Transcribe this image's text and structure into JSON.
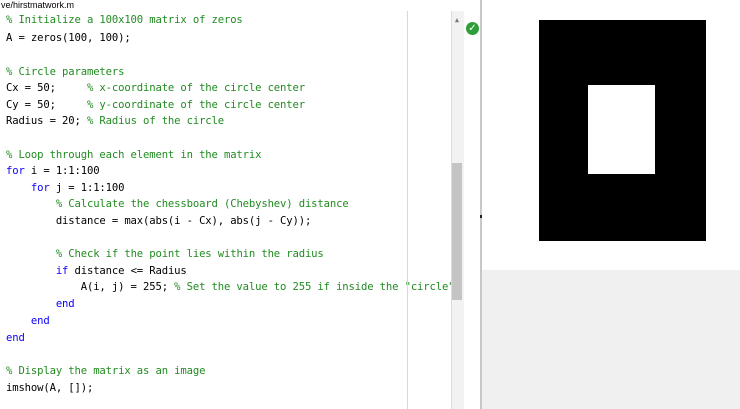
{
  "editor": {
    "file_path": "ve/hirstmatwork.m",
    "lines": [
      [
        {
          "t": "% Initialize a 100x100 matrix of zeros",
          "c": "cm"
        }
      ],
      [
        {
          "t": "A = zeros(100, 100);",
          "c": ""
        }
      ],
      [],
      [
        {
          "t": "% Circle parameters",
          "c": "cm"
        }
      ],
      [
        {
          "t": "Cx = 50;     ",
          "c": ""
        },
        {
          "t": "% x-coordinate of the circle center",
          "c": "cm"
        }
      ],
      [
        {
          "t": "Cy = 50;     ",
          "c": ""
        },
        {
          "t": "% y-coordinate of the circle center",
          "c": "cm"
        }
      ],
      [
        {
          "t": "Radius = 20; ",
          "c": ""
        },
        {
          "t": "% Radius of the circle",
          "c": "cm"
        }
      ],
      [],
      [
        {
          "t": "% Loop through each element in the matrix",
          "c": "cm"
        }
      ],
      [
        {
          "t": "for",
          "c": "kw"
        },
        {
          "t": " i = 1:1:100",
          "c": ""
        }
      ],
      [
        {
          "t": "    ",
          "c": ""
        },
        {
          "t": "for",
          "c": "kw"
        },
        {
          "t": " j = 1:1:100",
          "c": ""
        }
      ],
      [
        {
          "t": "        ",
          "c": ""
        },
        {
          "t": "% Calculate the chessboard (Chebyshev) distance",
          "c": "cm"
        }
      ],
      [
        {
          "t": "        distance = max(abs(i - Cx), abs(j - Cy));",
          "c": ""
        }
      ],
      [],
      [
        {
          "t": "        ",
          "c": ""
        },
        {
          "t": "% Check if the point lies within the radius",
          "c": "cm"
        }
      ],
      [
        {
          "t": "        ",
          "c": ""
        },
        {
          "t": "if",
          "c": "kw"
        },
        {
          "t": " distance <= Radius",
          "c": ""
        }
      ],
      [
        {
          "t": "            A(i, j) = 255; ",
          "c": ""
        },
        {
          "t": "% Set the value to 255 if inside the \"circle\"",
          "c": "cm"
        }
      ],
      [
        {
          "t": "        ",
          "c": ""
        },
        {
          "t": "end",
          "c": "kw"
        }
      ],
      [
        {
          "t": "    ",
          "c": ""
        },
        {
          "t": "end",
          "c": "kw"
        }
      ],
      [
        {
          "t": "end",
          "c": "kw"
        }
      ],
      [],
      [
        {
          "t": "% Display the matrix as an image",
          "c": "cm"
        }
      ],
      [
        {
          "t": "imshow(A, []);",
          "c": ""
        }
      ]
    ]
  },
  "status": {
    "icon": "check-icon",
    "glyph": "✓",
    "color": "#2f9e3a"
  },
  "figure": {
    "image": "black-image-with-white-square",
    "background_color": "#000000",
    "foreground_color": "#ffffff"
  }
}
